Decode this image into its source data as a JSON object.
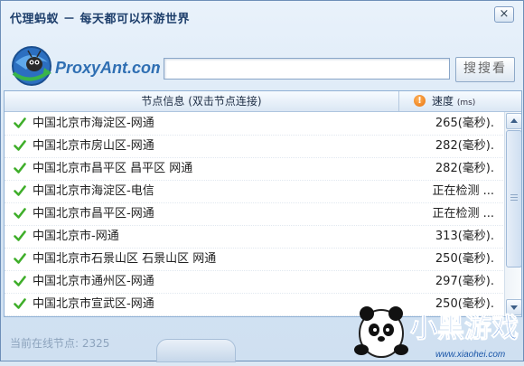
{
  "window": {
    "title": "代理蚂蚁 － 每天都可以环游世界",
    "close_label": "×"
  },
  "logo": {
    "brand": "ProxyAnt.com"
  },
  "search": {
    "value": "",
    "placeholder": "",
    "button_label": "搜搜看"
  },
  "list": {
    "header_name": "节点信息 (双击节点连接)",
    "header_speed": "速度",
    "header_speed_unit": "(ms)",
    "rows": [
      {
        "name": "中国北京市海淀区-网通",
        "speed": "265(毫秒)."
      },
      {
        "name": "中国北京市房山区-网通",
        "speed": "282(毫秒)."
      },
      {
        "name": "中国北京市昌平区 昌平区  网通",
        "speed": "282(毫秒)."
      },
      {
        "name": "中国北京市海淀区-电信",
        "speed": "正在检测 ..."
      },
      {
        "name": "中国北京市昌平区-网通",
        "speed": "正在检测 ..."
      },
      {
        "name": "中国北京市-网通",
        "speed": "313(毫秒)."
      },
      {
        "name": "中国北京市石景山区 石景山区  网通",
        "speed": "250(毫秒)."
      },
      {
        "name": "中国北京市通州区-网通",
        "speed": "297(毫秒)."
      },
      {
        "name": "中国北京市宣武区-网通",
        "speed": "250(毫秒)."
      }
    ]
  },
  "status": {
    "online_nodes": "当前在线节点: 2325"
  },
  "watermark": {
    "text": "小黑游戏",
    "url": "www.xiaohei.com"
  },
  "colors": {
    "accent": "#2f6fb3",
    "check": "#3fae2a",
    "warning": "#e8720c"
  }
}
